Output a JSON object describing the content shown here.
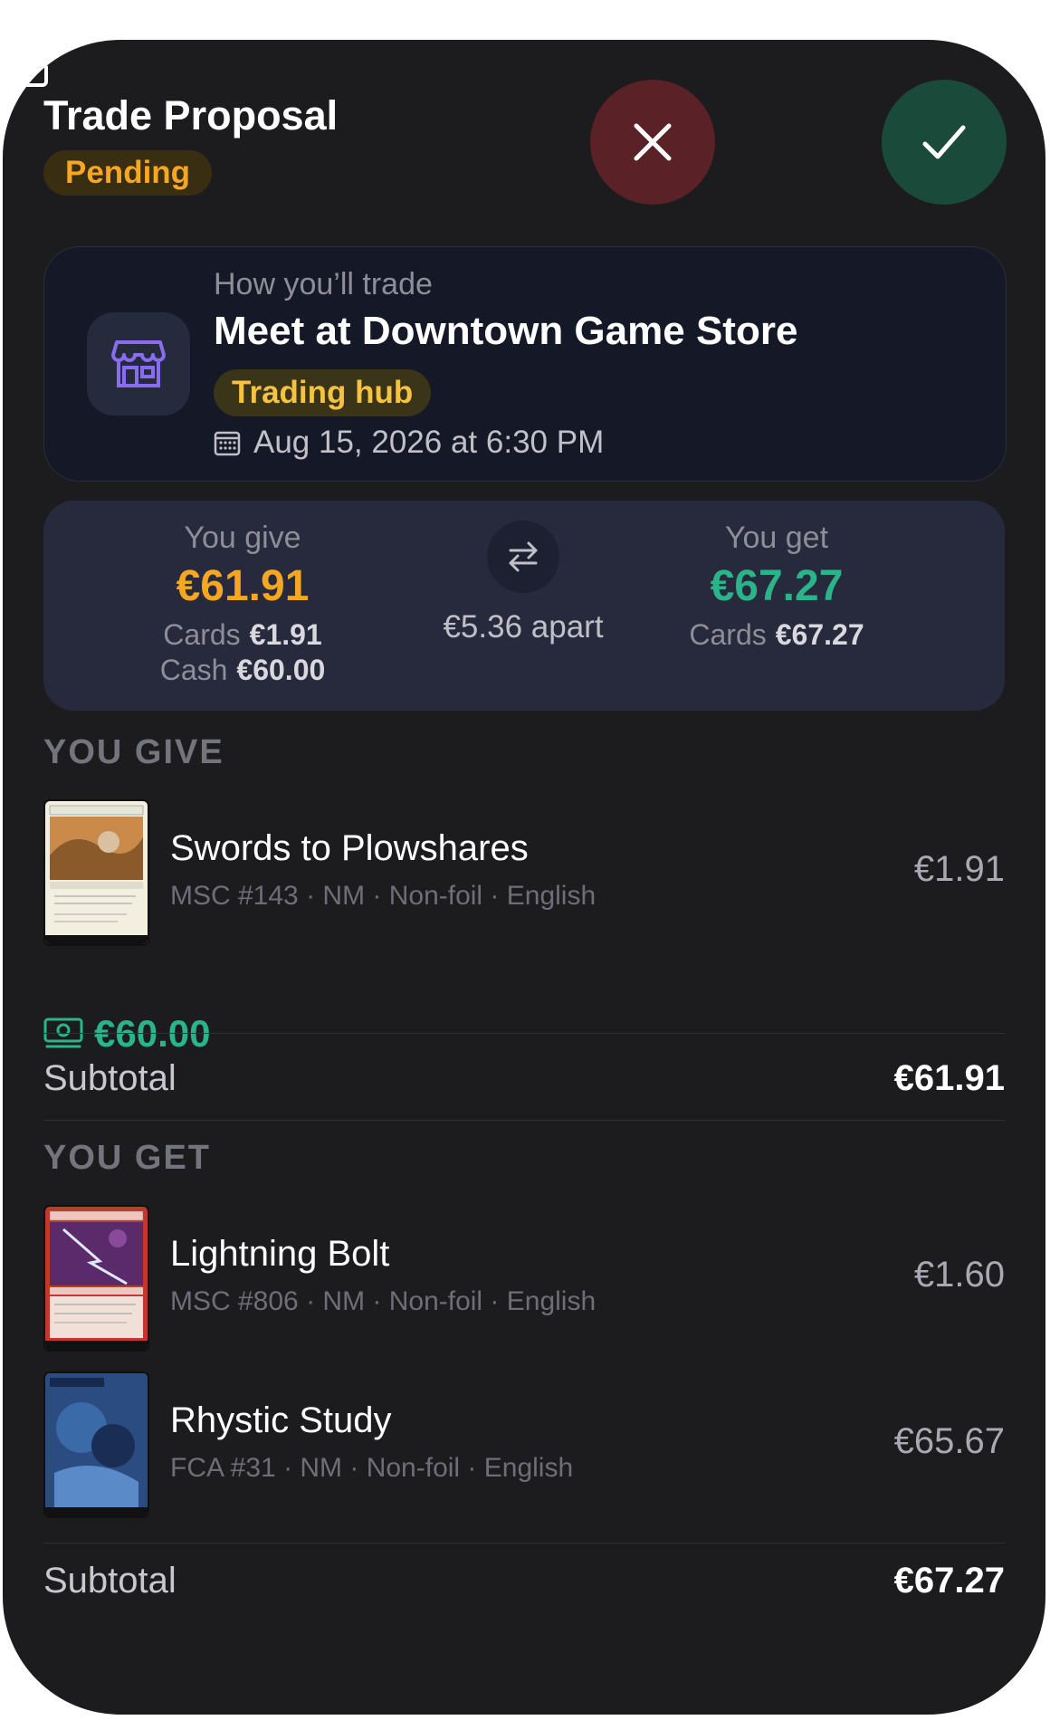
{
  "header": {
    "title": "Trade Proposal",
    "status": "Pending"
  },
  "meetup": {
    "label": "How you’ll trade",
    "place": "Meet at Downtown Game Store",
    "badge": "Trading hub",
    "datetime": "Aug 15, 2026 at 6:30 PM"
  },
  "summary": {
    "give": {
      "label": "You give",
      "total": "€61.91",
      "cards_label": "Cards",
      "cards_value": "€1.91",
      "cash_label": "Cash",
      "cash_value": "€60.00"
    },
    "difference": "€5.36 apart",
    "get": {
      "label": "You get",
      "total": "€67.27",
      "cards_label": "Cards",
      "cards_value": "€67.27"
    }
  },
  "you_give": {
    "heading": "YOU GIVE",
    "cards": [
      {
        "name": "Swords to Plowshares",
        "meta": "MSC #143 · NM · Non-foil · English",
        "price": "€1.91"
      }
    ],
    "cash": "€60.00",
    "subtotal_label": "Subtotal",
    "subtotal_value": "€61.91"
  },
  "you_get": {
    "heading": "YOU GET",
    "cards": [
      {
        "name": "Lightning Bolt",
        "meta": "MSC #806 · NM · Non-foil · English",
        "price": "€1.60"
      },
      {
        "name": "Rhystic Study",
        "meta": "FCA #31 · NM · Non-foil · English",
        "price": "€65.67"
      }
    ],
    "subtotal_label": "Subtotal",
    "subtotal_value": "€67.27"
  },
  "colors": {
    "background": "#1c1c1e",
    "pending": "#f5a623",
    "positive": "#2bb389",
    "decline": "#5a2227",
    "accept": "#1a4a3a",
    "hub": "#f5c242",
    "store_icon": "#8a6cf0"
  },
  "icons": {
    "decline": "close-icon",
    "edit": "edit-icon",
    "accept": "checkmark-icon",
    "store": "store-icon",
    "calendar": "calendar-icon",
    "swap": "swap-arrows-icon",
    "cash": "cash-icon"
  }
}
